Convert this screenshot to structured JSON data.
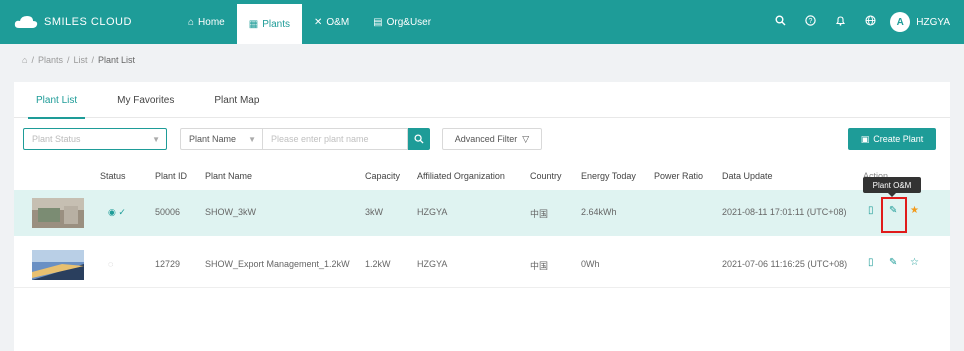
{
  "app": {
    "name": "SMILES CLOUD"
  },
  "nav": {
    "items": [
      {
        "label": "Home",
        "icon": "home-icon"
      },
      {
        "label": "Plants",
        "icon": "plants-icon",
        "active": true
      },
      {
        "label": "O&M",
        "icon": "tools-icon"
      },
      {
        "label": "Org&User",
        "icon": "org-icon"
      }
    ],
    "user": {
      "initial": "A",
      "name": "HZGYA"
    }
  },
  "breadcrumb": {
    "items": [
      "Plants",
      "List",
      "Plant List"
    ]
  },
  "tabs": [
    "Plant List",
    "My Favorites",
    "Plant Map"
  ],
  "filter": {
    "status_placeholder": "Plant Status",
    "field_select": "Plant Name",
    "search_placeholder": "Please enter plant name",
    "advanced_label": "Advanced Filter",
    "create_label": "Create Plant"
  },
  "table": {
    "columns": [
      "Status",
      "Plant ID",
      "Plant Name",
      "Capacity",
      "Affiliated Organization",
      "Country",
      "Energy Today",
      "Power Ratio",
      "Data Update",
      "Action"
    ],
    "rows": [
      {
        "plant_id": "50006",
        "plant_name": "SHOW_3kW",
        "capacity": "3kW",
        "org": "HZGYA",
        "country": "中国",
        "energy_today": "2.64kWh",
        "power_ratio": "",
        "data_update": "2021-08-11 17:01:11 (UTC+08)",
        "favorite": true
      },
      {
        "plant_id": "12729",
        "plant_name": "SHOW_Export Management_1.2kW",
        "capacity": "1.2kW",
        "org": "HZGYA",
        "country": "中国",
        "energy_today": "0Wh",
        "power_ratio": "",
        "data_update": "2021-07-06 11:16:25 (UTC+08)",
        "favorite": false
      }
    ]
  },
  "tooltip": "Plant O&M",
  "colors": {
    "brand": "#1e9c98",
    "row_highlight": "#dff3f1",
    "favorite": "#f29a1c",
    "callout": "#e01b1b"
  }
}
